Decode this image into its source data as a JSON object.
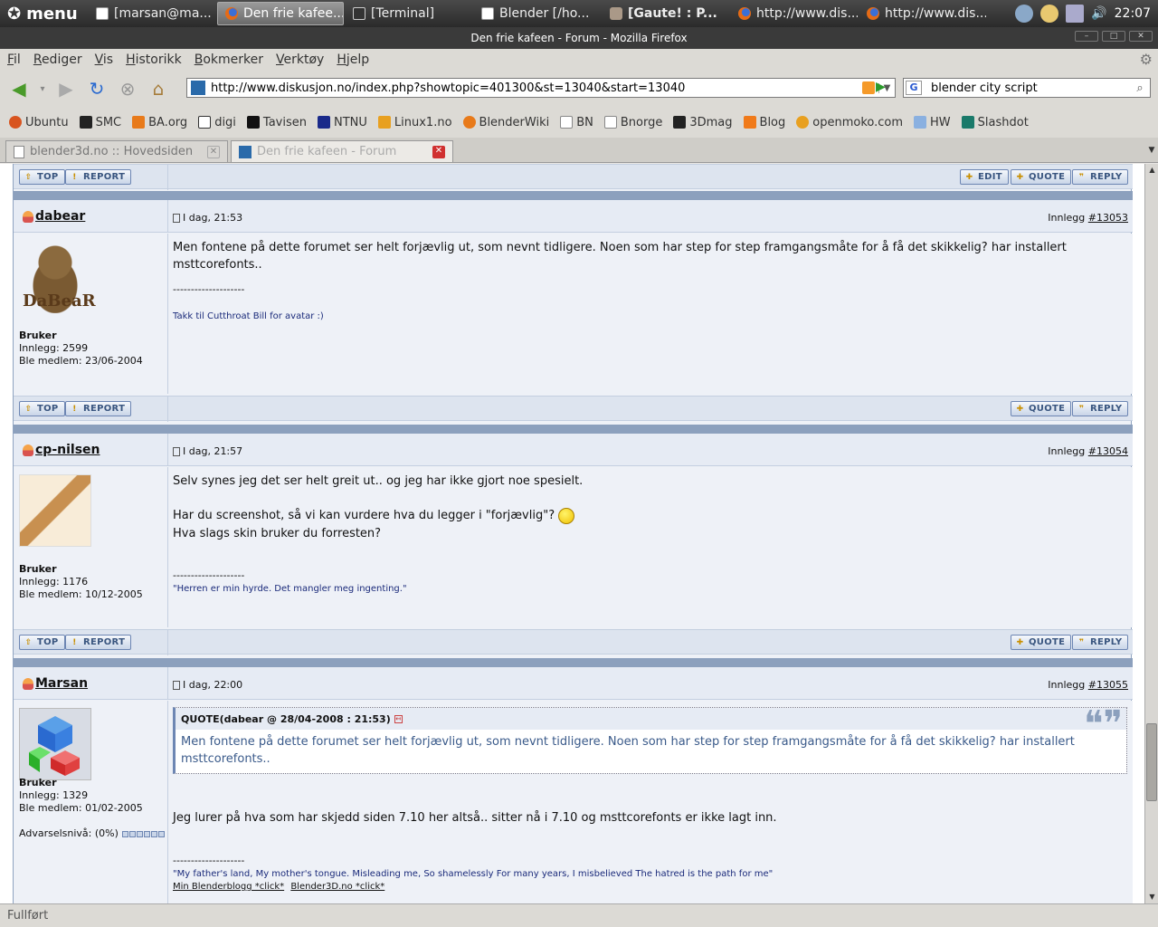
{
  "panel": {
    "menu_label": "menu",
    "tasks": [
      {
        "label": "[marsan@ma..."
      },
      {
        "label": "Den frie kafee..."
      },
      {
        "label": "[Terminal]"
      },
      {
        "label": "Blender [/ho..."
      },
      {
        "label": "[Gaute! : P..."
      },
      {
        "label": "http://www.dis..."
      },
      {
        "label": "http://www.dis..."
      }
    ],
    "clock": "22:07"
  },
  "window": {
    "title": "Den frie kafeen - Forum - Mozilla Firefox"
  },
  "menubar": [
    "Fil",
    "Rediger",
    "Vis",
    "Historikk",
    "Bokmerker",
    "Verktøy",
    "Hjelp"
  ],
  "nav": {
    "url": "http://www.diskusjon.no/index.php?showtopic=401300&st=13040&start=13040",
    "search": "blender city script"
  },
  "bookmarks": [
    "Ubuntu",
    "SMC",
    "BA.org",
    "digi",
    "Tavisen",
    "NTNU",
    "Linux1.no",
    "BlenderWiki",
    "BN",
    "Bnorge",
    "3Dmag",
    "Blog",
    "openmoko.com",
    "HW",
    "Slashdot"
  ],
  "tabs": [
    {
      "label": "blender3d.no :: Hovedsiden"
    },
    {
      "label": "Den frie kafeen - Forum"
    }
  ],
  "buttons": {
    "top": "TOP",
    "report": "REPORT",
    "edit": "EDIT",
    "quote": "QUOTE",
    "reply": "REPLY"
  },
  "posts": [
    {
      "username": "dabear",
      "date": "I dag, 21:53",
      "post_label": "Innlegg",
      "post_number": "#13053",
      "avatar_text": "DaBeaR",
      "role": "Bruker",
      "post_count": "Innlegg: 2599",
      "member_since": "Ble medlem: 23/06-2004",
      "message": "Men fontene på dette forumet ser helt forjævlig ut, som nevnt tidligere. Noen som har step for step framgangsmåte for å få det skikkelig? har installert msttcorefonts..",
      "sig_separator": "--------------------",
      "signature": "Takk til Cutthroat Bill for avatar :)"
    },
    {
      "username": "cp-nilsen",
      "date": "I dag, 21:57",
      "post_label": "Innlegg",
      "post_number": "#13054",
      "role": "Bruker",
      "post_count": "Innlegg: 1176",
      "member_since": "Ble medlem: 10/12-2005",
      "message_lines": [
        "Selv synes jeg det ser helt greit ut.. og jeg har ikke gjort noe spesielt.",
        "Har du screenshot, så vi kan vurdere hva du legger i \"forjævlig\"?",
        "Hva slags skin bruker du forresten?"
      ],
      "sig_separator": "--------------------",
      "signature": "\"Herren er min hyrde. Det mangler meg ingenting.\""
    },
    {
      "username": "Marsan",
      "date": "I dag, 22:00",
      "post_label": "Innlegg",
      "post_number": "#13055",
      "role": "Bruker",
      "post_count": "Innlegg: 1329",
      "member_since": "Ble medlem: 01/02-2005",
      "warn_label": "Advarselsnivå: (0%)",
      "quote_header": "QUOTE(dabear @ 28/04-2008 : 21:53)",
      "quote_text": "Men fontene på dette forumet ser helt forjævlig ut, som nevnt tidligere. Noen som har step for step framgangsmåte for å få det skikkelig? har installert msttcorefonts..",
      "message": "Jeg lurer på hva som har skjedd siden 7.10 her altså.. sitter nå i 7.10 og msttcorefonts er ikke lagt inn.",
      "sig_separator": "--------------------",
      "signature": "\"My father's land, My mother's tongue. Misleading me, So shamelessly For many years, I misbelieved The hatred is the path for me\"",
      "sig_links": [
        "Min Blenderblogg *click*",
        "Blender3D.no *click*"
      ]
    }
  ],
  "status": "Fullført"
}
